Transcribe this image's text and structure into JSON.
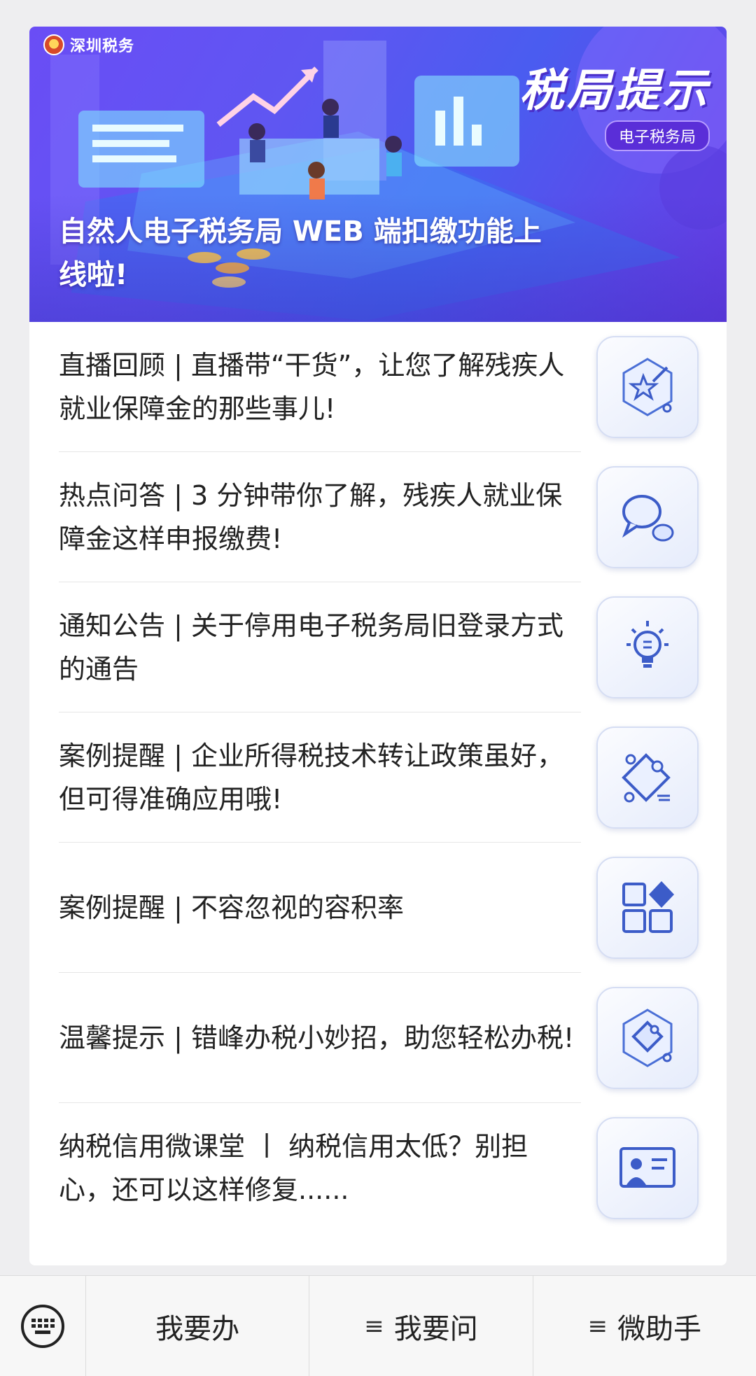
{
  "banner": {
    "brand": "深圳税务",
    "title": "税局提示",
    "subtitle": "电子税务局",
    "caption": "自然人电子税务局 WEB 端扣缴功能上线啦!"
  },
  "articles": [
    {
      "title": "直播回顾 | 直播带“干货”，让您了解残疾人就业保障金的那些事儿!",
      "icon": "star-wand-icon"
    },
    {
      "title": "热点问答 | 3 分钟带你了解，残疾人就业保障金这样申报缴费!",
      "icon": "chat-bubble-icon"
    },
    {
      "title": "通知公告 | 关于停用电子税务局旧登录方式的通告",
      "icon": "lightbulb-icon"
    },
    {
      "title": "案例提醒 | 企业所得税技术转让政策虽好，但可得准确应用哦!",
      "icon": "puzzle-icon"
    },
    {
      "title": "案例提醒 | 不容忽视的容积率",
      "icon": "grid-apps-icon"
    },
    {
      "title": "温馨提示 | 错峰办税小妙招，助您轻松办税!",
      "icon": "puzzle-hexagon-icon"
    },
    {
      "title": "纳税信用微课堂 丨 纳税信用太低？别担心，还可以这样修复......",
      "icon": "presentation-icon"
    }
  ],
  "bottom_menu": {
    "keyboard_icon": "keyboard-icon",
    "items": [
      {
        "label": "我要办",
        "has_menu": false
      },
      {
        "label": "我要问",
        "has_menu": true
      },
      {
        "label": "微助手",
        "has_menu": true
      }
    ],
    "menu_glyph": "≡"
  }
}
